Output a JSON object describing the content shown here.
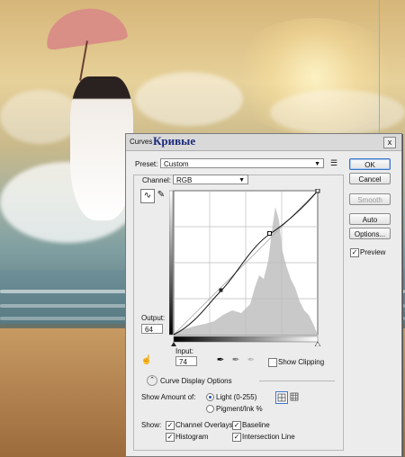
{
  "dialog": {
    "title": "Curves",
    "overlay_title": "Кривые",
    "close": "x"
  },
  "preset": {
    "label": "Preset:",
    "value": "Custom",
    "menu_icon": "list-menu-icon"
  },
  "channel": {
    "label": "Channel:",
    "value": "RGB"
  },
  "buttons": {
    "ok": "OK",
    "cancel": "Cancel",
    "smooth": "Smooth",
    "auto": "Auto",
    "options": "Options..."
  },
  "preview": {
    "label": "Preview",
    "checked": true
  },
  "output": {
    "label": "Output:",
    "value": "64"
  },
  "input": {
    "label": "Input:",
    "value": "74"
  },
  "show_clipping": {
    "label": "Show Clipping",
    "checked": false
  },
  "curve_display": {
    "label": "Curve Display Options"
  },
  "show_amount": {
    "label": "Show Amount of:",
    "light": "Light  (0-255)",
    "pigment": "Pigment/Ink %",
    "selected": "light"
  },
  "show": {
    "label": "Show:",
    "channel_overlays": "Channel Overlays",
    "baseline": "Baseline",
    "histogram": "Histogram",
    "intersection_line": "Intersection Line"
  },
  "curve": {
    "points": [
      [
        0,
        0
      ],
      [
        74,
        64
      ],
      [
        160,
        178
      ],
      [
        255,
        255
      ]
    ],
    "selected_point": [
      160,
      178
    ]
  },
  "colors": {
    "accent": "#3b74c5",
    "title_ru": "#1c2a7a",
    "histogram": "#c9c9c9"
  }
}
